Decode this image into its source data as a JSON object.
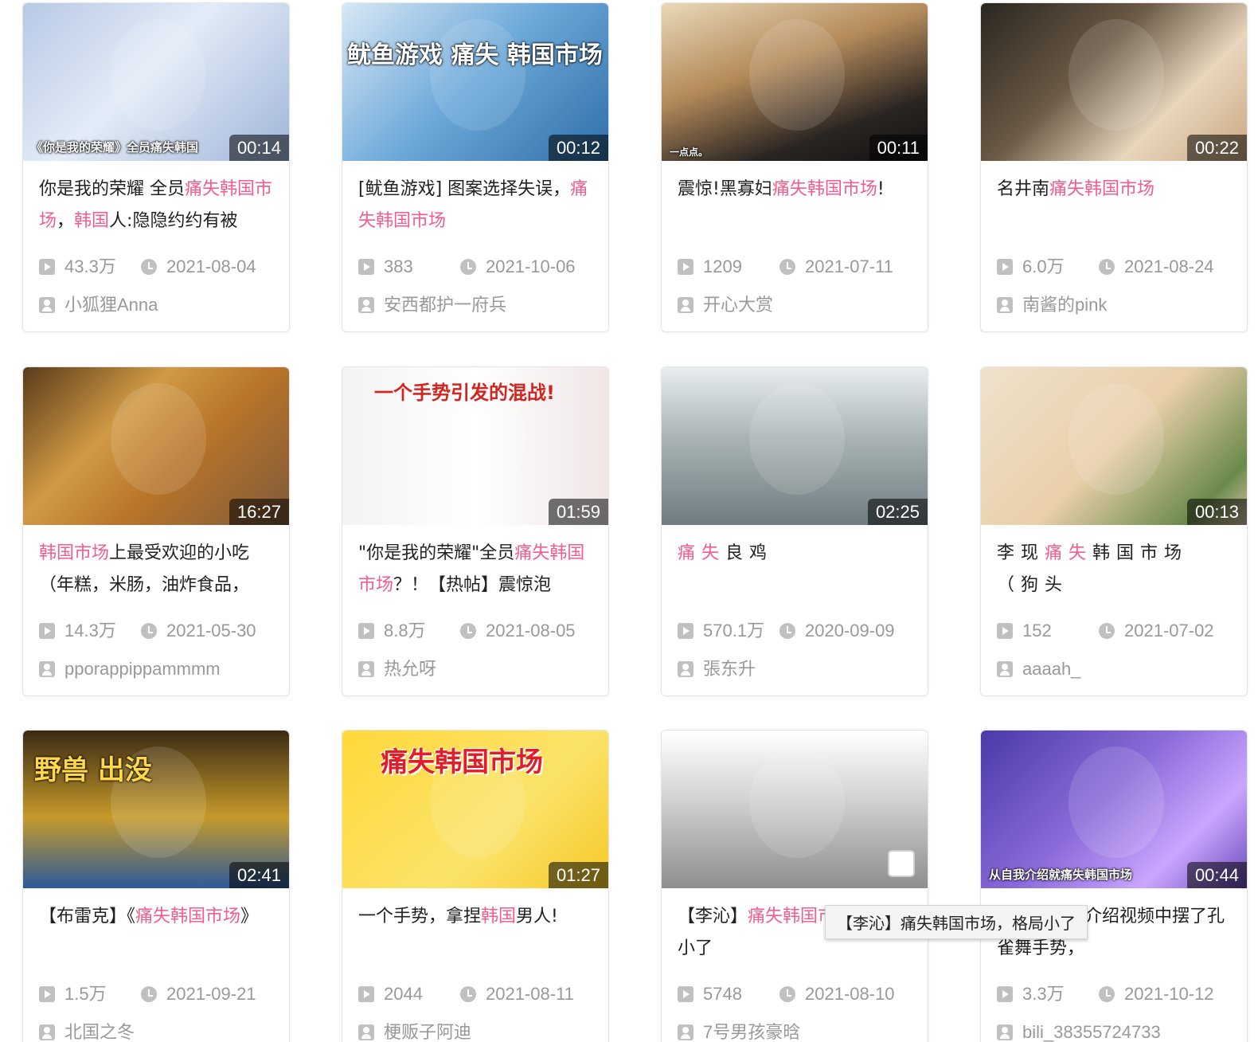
{
  "theme": {
    "highlight_color": "#f25d8e",
    "meta_color": "#999999",
    "title_color": "#212121"
  },
  "videos": [
    {
      "duration": "00:14",
      "title": [
        {
          "t": "你是我的荣耀 全员"
        },
        {
          "t": "痛失韩国市场",
          "hl": true
        },
        {
          "t": "，"
        },
        {
          "t": "韩国",
          "hl": true
        },
        {
          "t": "人:隐隐约约有被"
        }
      ],
      "views": "43.3万",
      "date": "2021-08-04",
      "author": "小狐狸Anna",
      "thumb": {
        "bg": "linear-gradient(135deg,#b7c9e6 0%,#e3ecf7 45%,#9fb5d9 100%)",
        "caption": "《你是我的荣耀》全员痛失韩国"
      }
    },
    {
      "duration": "00:12",
      "title": [
        {
          "t": "[鱿鱼游戏] 图案选择失误，"
        },
        {
          "t": "痛失韩国市场",
          "hl": true
        }
      ],
      "views": "383",
      "date": "2021-10-06",
      "author": "安西都护一府兵",
      "thumb": {
        "bg": "linear-gradient(135deg,#d8e8f5 0%,#6aa7d8 50%,#2f6ea8 100%)",
        "caption": "鱿鱼游戏 痛失 韩国市场"
      }
    },
    {
      "duration": "00:11",
      "title": [
        {
          "t": "震惊!黑寡妇"
        },
        {
          "t": "痛失韩国市场",
          "hl": true
        },
        {
          "t": "!"
        }
      ],
      "views": "1209",
      "date": "2021-07-11",
      "author": "开心大赏",
      "thumb": {
        "bg": "linear-gradient(160deg,#e9d9b8 0%,#b48a5a 40%,#2a2522 75%,#111 100%)",
        "caption": "一点点。"
      }
    },
    {
      "duration": "00:22",
      "title": [
        {
          "t": "名井南"
        },
        {
          "t": "痛失韩国市场",
          "hl": true
        }
      ],
      "views": "6.0万",
      "date": "2021-08-24",
      "author": "南酱的pink",
      "thumb": {
        "bg": "linear-gradient(135deg,#2a2620 0%,#6b5a46 40%,#e8d6bd 70%,#c9a77f 100%)",
        "caption": ""
      }
    },
    {
      "duration": "16:27",
      "title": [
        {
          "t": "韩国市场",
          "hl": true
        },
        {
          "t": "上最受欢迎的小吃（年糕，米肠，油炸食品，"
        }
      ],
      "views": "14.3万",
      "date": "2021-05-30",
      "author": "pporappippammmm",
      "thumb": {
        "bg": "linear-gradient(135deg,#5a3a1a 0%,#d09a45 35%,#b8742a 60%,#7d5a3a 100%)",
        "caption": ""
      }
    },
    {
      "duration": "01:59",
      "title": [
        {
          "t": "\"你是我的荣耀\"全员"
        },
        {
          "t": "痛失韩国市场",
          "hl": true
        },
        {
          "t": "？！【热帖】震惊泡"
        }
      ],
      "views": "8.8万",
      "date": "2021-08-05",
      "author": "热允呀",
      "thumb": {
        "bg": "linear-gradient(90deg,#f3f3f3 0%,#ffffff 50%,#f0e6e6 100%)",
        "caption": "一个手势引发的混战!"
      }
    },
    {
      "duration": "02:25",
      "title": [
        {
          "t": "痛失",
          "hl": true,
          "sp": true
        },
        {
          "t": "良鸡",
          "sp": true
        }
      ],
      "views": "570.1万",
      "date": "2020-09-09",
      "author": "張东升",
      "thumb": {
        "bg": "linear-gradient(180deg,#e9eef0 0%,#a9b3b5 45%,#6f7c80 100%)",
        "caption": ""
      }
    },
    {
      "duration": "00:13",
      "title": [
        {
          "t": "李现",
          "sp": true
        },
        {
          "t": "痛失",
          "hl": true,
          "sp": true
        },
        {
          "t": "韩国市场（狗头",
          "sp": true
        }
      ],
      "views": "152",
      "date": "2021-07-02",
      "author": "aaaah_",
      "thumb": {
        "bg": "linear-gradient(135deg,#efe2cc 0%,#e9cfa9 50%,#6a8a4a 85%,#d8c4a6 100%)",
        "caption": ""
      }
    },
    {
      "duration": "02:41",
      "title": [
        {
          "t": "【布雷克】《"
        },
        {
          "t": "痛失韩国市场",
          "hl": true
        },
        {
          "t": "》"
        }
      ],
      "views": "1.5万",
      "date": "2021-09-21",
      "author": "北国之冬",
      "thumb": {
        "bg": "linear-gradient(180deg,#3a2a14 0%,#c69a2a 55%,#2c5a9a 100%)",
        "caption": "野兽          出没"
      }
    },
    {
      "duration": "01:27",
      "title": [
        {
          "t": "一个手势，拿捏"
        },
        {
          "t": "韩国",
          "hl": true
        },
        {
          "t": "男人!"
        }
      ],
      "views": "2044",
      "date": "2021-08-11",
      "author": "梗贩子阿迪",
      "thumb": {
        "bg": "linear-gradient(135deg,#ffd93b 0%,#fbe36a 60%,#f6c928 100%)",
        "caption": "痛失韩国市场"
      }
    },
    {
      "duration": "",
      "title": [
        {
          "t": "【李沁】"
        },
        {
          "t": "痛失韩国市场",
          "hl": true
        },
        {
          "t": "，格局小了"
        }
      ],
      "views": "5748",
      "date": "2021-08-10",
      "author": "7号男孩豪晗",
      "thumb": {
        "bg": "linear-gradient(180deg,#ffffff 0%,#d6d6d6 40%,#8e8e8e 100%)",
        "caption": ""
      }
    },
    {
      "duration": "00:44",
      "title": [
        {
          "t": "因为在自我介绍视频中摆了孔雀舞手势，"
        }
      ],
      "views": "3.3万",
      "date": "2021-10-12",
      "author": "bili_38355724733",
      "thumb": {
        "bg": "linear-gradient(135deg,#4a3aa8 0%,#8a6ad8 45%,#c9a6ff 75%,#6a4ab8 100%)",
        "caption": "从自我介绍就痛失韩国市场"
      }
    }
  ],
  "tooltip": "【李沁】痛失韩国市场，格局小了"
}
